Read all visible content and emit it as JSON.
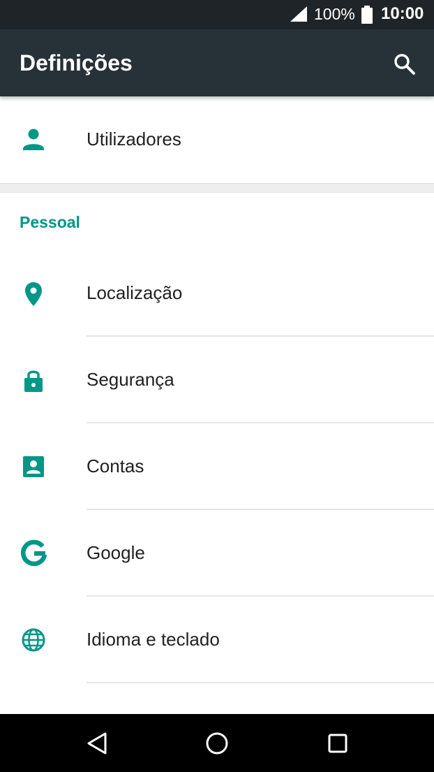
{
  "status_bar": {
    "battery_percent": "100%",
    "time": "10:00",
    "icons": [
      "cell-signal-icon",
      "battery-icon"
    ]
  },
  "app_bar": {
    "title": "Definições",
    "search_icon": "search-icon"
  },
  "users_row": {
    "label": "Utilizadores",
    "icon": "person-icon"
  },
  "section": {
    "header": "Pessoal"
  },
  "items": [
    {
      "label": "Localização",
      "icon": "location-pin-icon"
    },
    {
      "label": "Segurança",
      "icon": "lock-icon"
    },
    {
      "label": "Contas",
      "icon": "account-box-icon"
    },
    {
      "label": "Google",
      "icon": "google-icon"
    },
    {
      "label": "Idioma e teclado",
      "icon": "globe-icon"
    }
  ],
  "colors": {
    "accent": "#009688",
    "app_bar": "#263238",
    "status_bar": "#1e2428",
    "nav_bar": "#000000",
    "text": "#212121"
  },
  "nav_bar": {
    "icons": [
      "back-icon",
      "home-icon",
      "recents-icon"
    ]
  }
}
